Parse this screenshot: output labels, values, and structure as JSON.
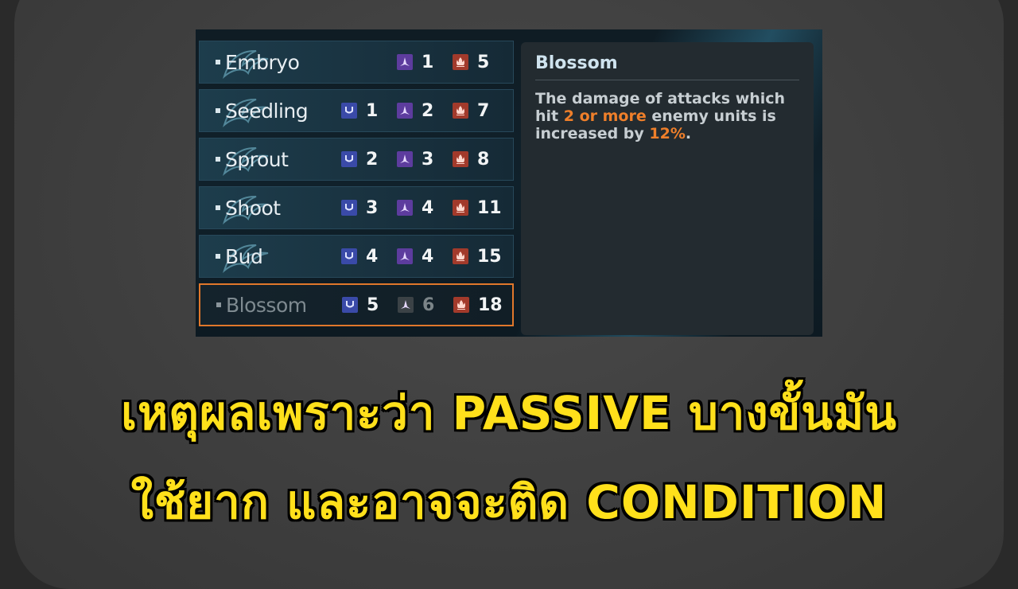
{
  "tiers": [
    {
      "name": "Embryo",
      "stats": [
        {
          "icon": "blade-icon",
          "value": "1"
        },
        {
          "icon": "fire-icon",
          "value": "5"
        }
      ]
    },
    {
      "name": "Seedling",
      "stats": [
        {
          "icon": "shield-icon",
          "value": "1"
        },
        {
          "icon": "blade-icon",
          "value": "2"
        },
        {
          "icon": "fire-icon",
          "value": "7"
        }
      ]
    },
    {
      "name": "Sprout",
      "stats": [
        {
          "icon": "shield-icon",
          "value": "2"
        },
        {
          "icon": "blade-icon",
          "value": "3"
        },
        {
          "icon": "fire-icon",
          "value": "8"
        }
      ]
    },
    {
      "name": "Shoot",
      "stats": [
        {
          "icon": "shield-icon",
          "value": "3"
        },
        {
          "icon": "blade-icon",
          "value": "4"
        },
        {
          "icon": "fire-icon",
          "value": "11"
        }
      ]
    },
    {
      "name": "Bud",
      "stats": [
        {
          "icon": "shield-icon",
          "value": "4"
        },
        {
          "icon": "blade-icon",
          "value": "4"
        },
        {
          "icon": "fire-icon",
          "value": "15"
        }
      ]
    },
    {
      "name": "Blossom",
      "selected": true,
      "stats": [
        {
          "icon": "shield-icon",
          "value": "5"
        },
        {
          "icon": "blade-icon",
          "value": "6",
          "dim": true
        },
        {
          "icon": "fire-icon",
          "value": "18"
        }
      ]
    }
  ],
  "tooltip": {
    "title": "Blossom",
    "text_1": "The damage of attacks which hit ",
    "highlight_1": "2 or more",
    "text_2": " enemy units is increased by ",
    "highlight_2": "12%",
    "text_3": "."
  },
  "caption": {
    "line1": "เหตุผลเพราะว่า PASSIVE บางขั้นมัน",
    "line2": "ใช้ยาก และอาจจะติด CONDITION"
  },
  "colors": {
    "caption": "#ffe01b",
    "highlight": "#ef7f2a",
    "selected_border": "#e0772b"
  }
}
